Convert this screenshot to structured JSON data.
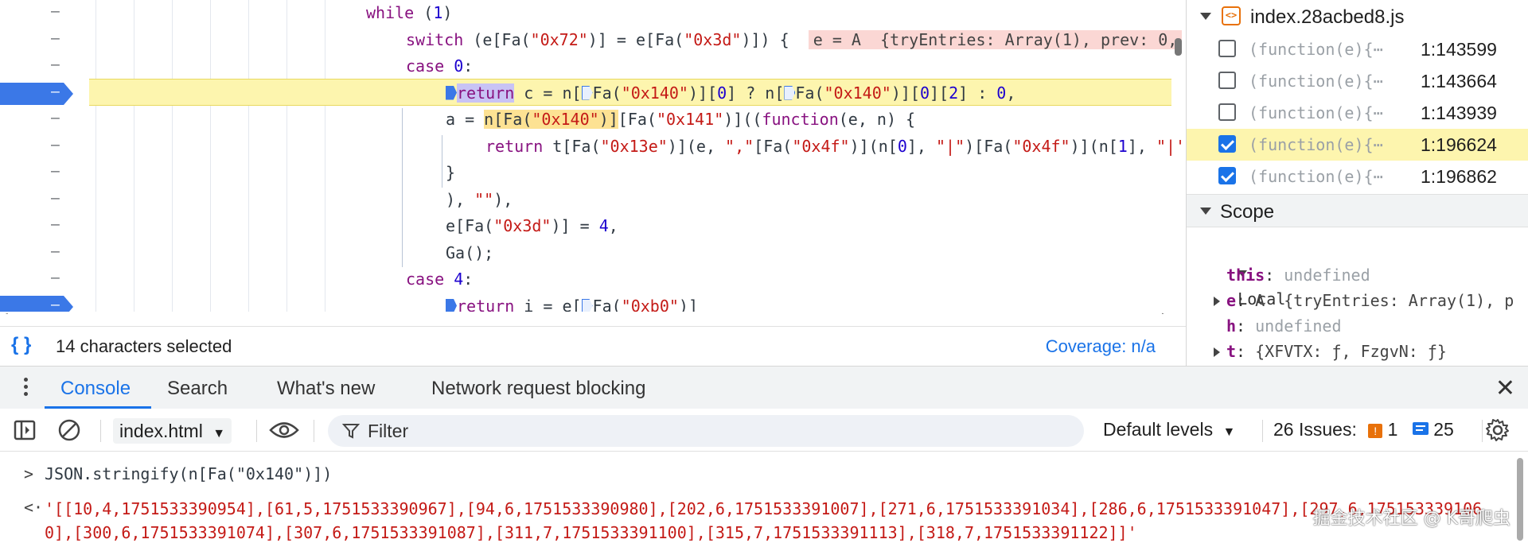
{
  "editor": {
    "lines": [
      {
        "parts": [
          {
            "t": "while",
            "c": "kw"
          },
          {
            "t": " (",
            "c": ""
          },
          {
            "t": "1",
            "c": "num"
          },
          {
            "t": ")",
            "c": ""
          }
        ]
      },
      {
        "parts": [
          {
            "t": "switch",
            "c": "kw"
          },
          {
            "t": " (e[Fa(",
            "c": ""
          },
          {
            "t": "\"0x72\"",
            "c": "str"
          },
          {
            "t": ")] = e[Fa(",
            "c": ""
          },
          {
            "t": "\"0x3d\"",
            "c": "str"
          },
          {
            "t": ")]) {  ",
            "c": ""
          },
          {
            "t": "e = A  {tryEntries: Array(1), prev: 0,",
            "c": "inline-val"
          }
        ]
      },
      {
        "parts": [
          {
            "t": "case",
            "c": "kw"
          },
          {
            "t": " ",
            "c": ""
          },
          {
            "t": "0",
            "c": "num"
          },
          {
            "t": ":",
            "c": ""
          }
        ]
      },
      {
        "parts": [
          {
            "t": "",
            "c": "bp"
          },
          {
            "t": "return",
            "c": "kw sel"
          },
          {
            "t": " c = n[",
            "c": ""
          },
          {
            "t": "",
            "c": "bpo"
          },
          {
            "t": "Fa(",
            "c": ""
          },
          {
            "t": "\"0x140\"",
            "c": "str"
          },
          {
            "t": ")][",
            "c": ""
          },
          {
            "t": "0",
            "c": "num"
          },
          {
            "t": "] ? n[",
            "c": ""
          },
          {
            "t": "",
            "c": "bpo"
          },
          {
            "t": "Fa(",
            "c": ""
          },
          {
            "t": "\"0x140\"",
            "c": "str"
          },
          {
            "t": ")][",
            "c": ""
          },
          {
            "t": "0",
            "c": "num"
          },
          {
            "t": "][",
            "c": ""
          },
          {
            "t": "2",
            "c": "num"
          },
          {
            "t": "] : ",
            "c": ""
          },
          {
            "t": "0",
            "c": "num"
          },
          {
            "t": ",",
            "c": ""
          }
        ]
      },
      {
        "parts": [
          {
            "t": "a = ",
            "c": ""
          },
          {
            "t": "n[Fa(",
            "c": "match"
          },
          {
            "t": "\"0x140\"",
            "c": "str match"
          },
          {
            "t": ")]",
            "c": "match"
          },
          {
            "t": "[Fa(",
            "c": ""
          },
          {
            "t": "\"0x141\"",
            "c": "str"
          },
          {
            "t": ")]((",
            "c": ""
          },
          {
            "t": "function",
            "c": "kw"
          },
          {
            "t": "(e, n) {",
            "c": ""
          }
        ]
      },
      {
        "parts": [
          {
            "t": "return",
            "c": "kw"
          },
          {
            "t": " t[Fa(",
            "c": ""
          },
          {
            "t": "\"0x13e\"",
            "c": "str"
          },
          {
            "t": ")](e, ",
            "c": ""
          },
          {
            "t": "\",\"",
            "c": "str"
          },
          {
            "t": "[Fa(",
            "c": ""
          },
          {
            "t": "\"0x4f\"",
            "c": "str"
          },
          {
            "t": ")](n[",
            "c": ""
          },
          {
            "t": "0",
            "c": "num"
          },
          {
            "t": "], ",
            "c": ""
          },
          {
            "t": "\"|\"",
            "c": "str"
          },
          {
            "t": ")[Fa(",
            "c": ""
          },
          {
            "t": "\"0x4f\"",
            "c": "str"
          },
          {
            "t": ")](n[",
            "c": ""
          },
          {
            "t": "1",
            "c": "num"
          },
          {
            "t": "], ",
            "c": ""
          },
          {
            "t": "\"|'",
            "c": "str"
          }
        ]
      },
      {
        "parts": [
          {
            "t": "}",
            "c": ""
          }
        ]
      },
      {
        "parts": [
          {
            "t": "), ",
            "c": ""
          },
          {
            "t": "\"\"",
            "c": "str"
          },
          {
            "t": "),",
            "c": ""
          }
        ]
      },
      {
        "parts": [
          {
            "t": "e[Fa(",
            "c": ""
          },
          {
            "t": "\"0x3d\"",
            "c": "str"
          },
          {
            "t": ")] = ",
            "c": ""
          },
          {
            "t": "4",
            "c": "num"
          },
          {
            "t": ",",
            "c": ""
          }
        ]
      },
      {
        "parts": [
          {
            "t": "Ga();",
            "c": ""
          }
        ]
      },
      {
        "parts": [
          {
            "t": "case",
            "c": "kw"
          },
          {
            "t": " ",
            "c": ""
          },
          {
            "t": "4",
            "c": "num"
          },
          {
            "t": ":",
            "c": ""
          }
        ]
      },
      {
        "parts": [
          {
            "t": "",
            "c": "bp"
          },
          {
            "t": "return",
            "c": "kw"
          },
          {
            "t": " i = e[",
            "c": ""
          },
          {
            "t": "",
            "c": "bpo"
          },
          {
            "t": "Fa(",
            "c": ""
          },
          {
            "t": "\"0xb0\"",
            "c": "str"
          },
          {
            "t": ")]",
            "c": ""
          }
        ]
      }
    ]
  },
  "status": {
    "braces": "{ }",
    "selection": "14 characters selected",
    "coverage": "Coverage: n/a"
  },
  "breakpoints": {
    "file": "index.28acbed8.js",
    "file_icon": "<>",
    "items": [
      {
        "snippet": "(function(e){⋯",
        "line": "1:143599",
        "checked": false
      },
      {
        "snippet": "(function(e){⋯",
        "line": "1:143664",
        "checked": false
      },
      {
        "snippet": "(function(e){⋯",
        "line": "1:143939",
        "checked": false
      },
      {
        "snippet": "(function(e){⋯",
        "line": "1:196624",
        "checked": true
      },
      {
        "snippet": "(function(e){⋯",
        "line": "1:196862",
        "checked": true
      }
    ]
  },
  "scope": {
    "title": "Scope",
    "local_label": "Local",
    "vars": [
      {
        "key": "this",
        "value": "undefined",
        "expandable": false
      },
      {
        "key": "e",
        "value": "A  {tryEntries: Array(1), p",
        "expandable": true
      },
      {
        "key": "h",
        "value": "undefined",
        "expandable": false
      },
      {
        "key": "t",
        "value": "{XFVTX: ƒ, FzgvN: ƒ}",
        "expandable": true
      }
    ]
  },
  "drawer": {
    "tabs": [
      "Console",
      "Search",
      "What's new",
      "Network request blocking"
    ],
    "active_tab": "Console"
  },
  "toolbar": {
    "context": "index.html",
    "filter_placeholder": "Filter",
    "levels": "Default levels",
    "issues_label": "26 Issues:",
    "issues_warn": "1",
    "issues_info": "25"
  },
  "console": {
    "command": "JSON.stringify(n[Fa(\"0x140\")])",
    "result": "'[[10,4,1751533390954],[61,5,1751533390967],[94,6,1751533390980],[202,6,1751533391007],[271,6,1751533391034],[286,6,1751533391047],[297,6,1751533391060],[300,6,1751533391074],[307,6,1751533391087],[311,7,1751533391100],[315,7,1751533391113],[318,7,1751533391122]]'",
    "watermark": "掘金技术社区 @ K哥爬虫"
  },
  "colors": {
    "accent": "#1a73e8",
    "paused_line": "#fdf5ae",
    "keyword": "#881280",
    "string": "#c41a16",
    "number": "#1c00cf"
  }
}
